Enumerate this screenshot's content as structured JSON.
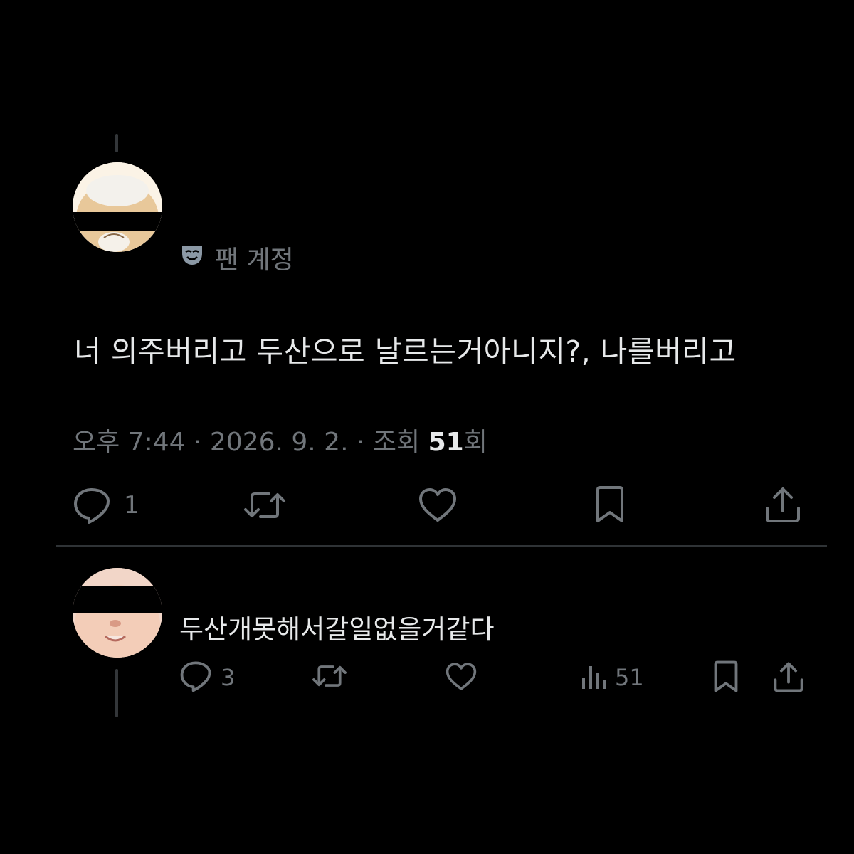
{
  "post": {
    "badge_label": "팬 계정",
    "badge_icon": "theater-mask-icon",
    "text": "너 의주버리고 두산으로 날르는거아니지?, 나를버리고",
    "meta": {
      "time": "오후 7:44",
      "separator": "·",
      "date": "2026. 9. 2.",
      "views_prefix": "조회",
      "views_count": "51",
      "views_suffix": "회"
    },
    "actions": {
      "reply_count": "1"
    }
  },
  "reply": {
    "text": "두산개못해서갈일없을거같다",
    "actions": {
      "reply_count": "3",
      "views_count": "51"
    }
  },
  "colors": {
    "background": "#000000",
    "text_primary": "#e7e9ea",
    "text_secondary": "#71767b",
    "divider": "#2f3336"
  }
}
